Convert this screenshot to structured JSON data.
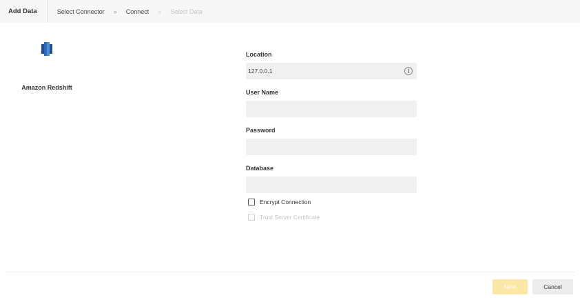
{
  "header": {
    "title": "Add Data",
    "breadcrumbs": [
      {
        "label": "Select Connector",
        "state": "done"
      },
      {
        "label": "Connect",
        "state": "active"
      },
      {
        "label": "Select Data",
        "state": "disabled"
      }
    ],
    "separator": "»"
  },
  "connector": {
    "name": "Amazon Redshift",
    "icon": "redshift-logo-icon",
    "colors": {
      "dark": "#1f4f8f",
      "mid": "#2b6cb8",
      "light": "#4f8fd6"
    }
  },
  "form": {
    "location": {
      "label": "Location",
      "value": "127.0.0.1",
      "info_icon": "info-icon"
    },
    "user_name": {
      "label": "User Name",
      "value": ""
    },
    "password": {
      "label": "Password",
      "value": ""
    },
    "database": {
      "label": "Database",
      "value": ""
    },
    "encrypt_connection": {
      "label": "Encrypt Connection",
      "checked": false
    },
    "trust_server_certificate": {
      "label": "Trust Server Certificate",
      "checked": false,
      "disabled": true
    }
  },
  "footer": {
    "next_label": "Next",
    "cancel_label": "Cancel"
  }
}
